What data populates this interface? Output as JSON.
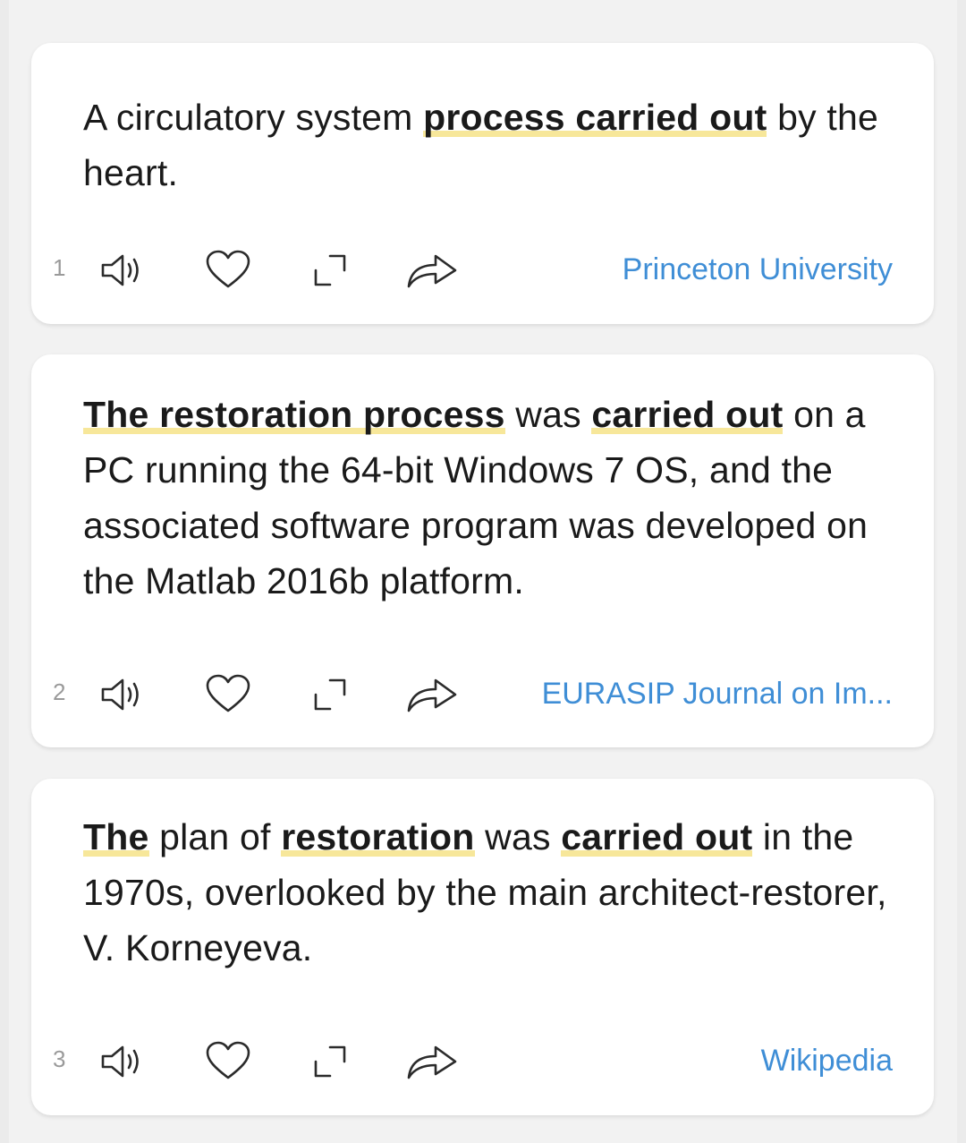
{
  "examples": [
    {
      "index": "1",
      "segments": [
        {
          "text": "A circulatory system ",
          "highlight": false
        },
        {
          "text": "process carried out",
          "highlight": true
        },
        {
          "text": " by the heart.",
          "highlight": false
        }
      ],
      "source": "Princeton University"
    },
    {
      "index": "2",
      "segments": [
        {
          "text": "The restoration process",
          "highlight": true
        },
        {
          "text": " was ",
          "highlight": false
        },
        {
          "text": "carried out",
          "highlight": true
        },
        {
          "text": " on a PC running the 64-bit Windows 7 OS, and the associated software program was developed on the Matlab 2016b platform.",
          "highlight": false
        }
      ],
      "source": "EURASIP Journal on Im..."
    },
    {
      "index": "3",
      "segments": [
        {
          "text": "The",
          "highlight": true
        },
        {
          "text": " plan of ",
          "highlight": false
        },
        {
          "text": "restoration",
          "highlight": true
        },
        {
          "text": " was ",
          "highlight": false
        },
        {
          "text": "carried out",
          "highlight": true
        },
        {
          "text": " in the 1970s, overlooked by the main architect-restorer, V. Korneyeva.",
          "highlight": false
        }
      ],
      "source": "Wikipedia"
    }
  ],
  "icons": [
    "speaker-icon",
    "heart-icon",
    "expand-icon",
    "share-icon"
  ],
  "colors": {
    "highlight": "#f7e79a",
    "source_link": "#3f8ed6",
    "card_bg": "#ffffff",
    "page_bg": "#f2f2f2"
  }
}
